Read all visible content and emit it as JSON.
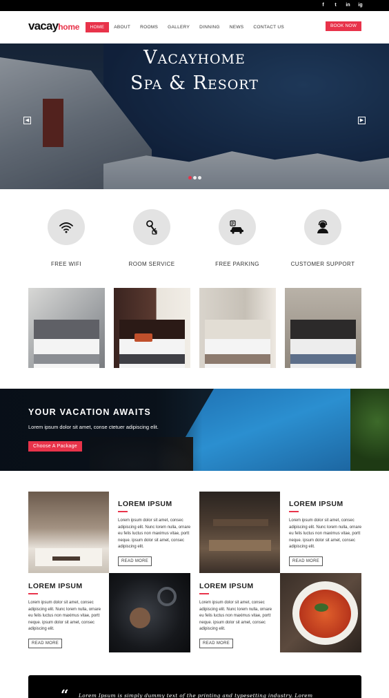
{
  "social": [
    "f",
    "t",
    "in",
    "ig"
  ],
  "header": {
    "logo_main": "vacay",
    "logo_accent": "home",
    "nav": [
      "HOME",
      "ABOUT",
      "ROOMS",
      "GALLERY",
      "DINNING",
      "NEWS",
      "CONTACT US"
    ],
    "active_nav": "HOME",
    "book_label": "BOOK NOW"
  },
  "hero": {
    "title_line1": "Vacayhome",
    "title_line2": "Spa & Resort",
    "prev_symbol": "◀",
    "next_symbol": "▶",
    "slide_count": 3,
    "active_slide": 1
  },
  "features": [
    {
      "icon": "wifi-icon",
      "label": "FREE WIFI"
    },
    {
      "icon": "room-key-icon",
      "label": "ROOM SERVICE"
    },
    {
      "icon": "parking-car-icon",
      "label": "FREE PARKING"
    },
    {
      "icon": "support-agent-icon",
      "label": "CUSTOMER SUPPORT"
    }
  ],
  "banner": {
    "title": "YOUR VACATION AWAITS",
    "text": "Lorem ipsum dolor sit amet, conse ctetuer adipiscing elit.",
    "button": "Choose A Package"
  },
  "cards": [
    {
      "title": "LOREM IPSUM",
      "body": "Lorem ipsum dolor sit amet, consec adipiscing elit. Nunc lorem nulla, ornare eu felis luctus non maximus vitae, portt neque. ipsum dolor sit amet, consec adipiscing elit.",
      "more": "READ MORE"
    },
    {
      "title": "LOREM IPSUM",
      "body": "Lorem ipsum dolor sit amet, consec adipiscing elit. Nunc lorem nulla, ornare eu felis luctus non maximus vitae, portt neque. ipsum dolor sit amet, consec adipiscing elit.",
      "more": "READ MORE"
    },
    {
      "title": "LOREM IPSUM",
      "body": "Lorem ipsum dolor sit amet, consec adipiscing elit. Nunc lorem nulla, ornare eu felis luctus non maximus vitae, portt neque. ipsum dolor sit amet, consec adipiscing elit.",
      "more": "READ MORE"
    },
    {
      "title": "LOREM IPSUM",
      "body": "Lorem ipsum dolor sit amet, consec adipiscing elit. Nunc lorem nulla, ornare eu felis luctus non maximus vitae, portt neque. ipsum dolor sit amet, consec adipiscing elit.",
      "more": "READ MORE"
    }
  ],
  "testimonial": {
    "mark": "“",
    "text": "Lorem Ipsum is simply dummy text of the printing and typesetting industry. Lorem"
  },
  "colors": {
    "accent": "#e8334a",
    "topbar": "#000000",
    "feature_circle": "#e3e3e3"
  }
}
